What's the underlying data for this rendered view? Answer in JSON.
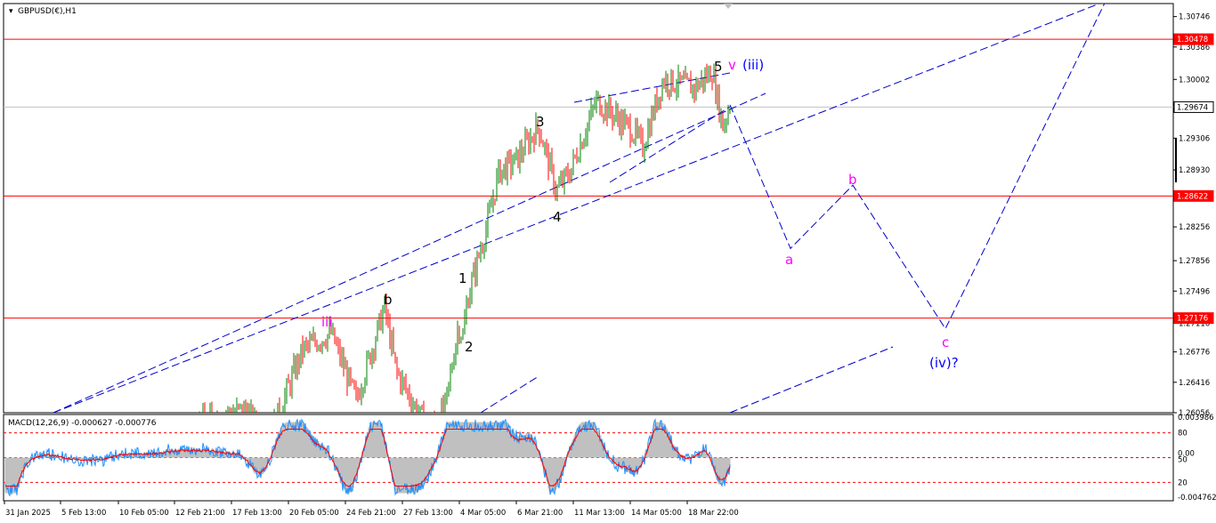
{
  "window": {
    "title": "GBPUSD(€),H1"
  },
  "main_axis": {
    "ticks": [
      "1.30746",
      "1.30386",
      "1.30002",
      "1.29306",
      "1.28930",
      "1.28256",
      "1.27856",
      "1.27496",
      "1.27116",
      "1.26776",
      "1.26416",
      "1.26056"
    ],
    "tick_values": [
      1.30746,
      1.30386,
      1.30002,
      1.29306,
      1.2893,
      1.28256,
      1.27856,
      1.27496,
      1.27116,
      1.26776,
      1.26416,
      1.26056
    ],
    "ylim": [
      1.26056,
      1.309
    ]
  },
  "horizontal_levels": [
    {
      "label": "1.30478",
      "value": 1.30478,
      "color": "#ff0000"
    },
    {
      "label": "1.29674",
      "value": 1.29674,
      "color": "#c0c0c0"
    },
    {
      "label": "1.28622",
      "value": 1.28622,
      "color": "#ff0000"
    },
    {
      "label": "1.27176",
      "value": 1.27176,
      "color": "#ff0000"
    }
  ],
  "time_axis": {
    "labels": [
      "31 Jan 2025",
      "5 Feb 13:00",
      "10 Feb 05:00",
      "12 Feb 21:00",
      "17 Feb 13:00",
      "20 Feb 05:00",
      "24 Feb 21:00",
      "27 Feb 13:00",
      "4 Mar 05:00",
      "6 Mar 21:00",
      "11 Mar 13:00",
      "14 Mar 05:00",
      "18 Mar 22:00"
    ]
  },
  "wave_labels": [
    {
      "text": "iii",
      "color": "#ff00ff"
    },
    {
      "text": "b",
      "color": "#000000"
    },
    {
      "text": "1",
      "color": "#000000"
    },
    {
      "text": "2",
      "color": "#000000"
    },
    {
      "text": "3",
      "color": "#000000"
    },
    {
      "text": "4",
      "color": "#000000"
    },
    {
      "text": "5",
      "color": "#000000"
    },
    {
      "text": "v",
      "color": "#ff00ff"
    },
    {
      "text": "(iii)",
      "color": "#0000ff"
    },
    {
      "text": "a",
      "color": "#ff00ff"
    },
    {
      "text": "b",
      "color": "#ff00ff"
    },
    {
      "text": "c",
      "color": "#ff00ff"
    },
    {
      "text": "(iv)?",
      "color": "#0000ff"
    }
  ],
  "macd": {
    "header": "MACD(12,26,9) -0.000627 -0.000776",
    "ticks": [
      "0.003986",
      "80",
      "0.00",
      "50",
      "20",
      "-0.004762"
    ]
  },
  "colors": {
    "bull": "#008000",
    "bear": "#ff0000",
    "projection": "#0000cd",
    "resistance": "#ff0000",
    "current": "#c0c0c0",
    "histogram": "#c0c0c0",
    "macd_main": "#1e90ff",
    "macd_signal": "#ff0000"
  },
  "chart_data": {
    "type": "candlestick",
    "symbol": "GBPUSD(€)",
    "timeframe": "H1",
    "path": [
      [
        0,
        1.254
      ],
      [
        60,
        1.2558
      ],
      [
        120,
        1.2548
      ],
      [
        180,
        1.2566
      ],
      [
        240,
        1.26
      ],
      [
        275,
        1.261
      ],
      [
        300,
        1.257
      ],
      [
        340,
        1.268
      ],
      [
        372,
        1.27
      ],
      [
        400,
        1.262
      ],
      [
        432,
        1.273
      ],
      [
        445,
        1.2655
      ],
      [
        480,
        1.2585
      ],
      [
        500,
        1.261
      ],
      [
        515,
        1.271
      ],
      [
        520,
        1.2695
      ],
      [
        525,
        1.274
      ],
      [
        550,
        1.284
      ],
      [
        560,
        1.289
      ],
      [
        580,
        1.2905
      ],
      [
        605,
        1.2945
      ],
      [
        625,
        1.2868
      ],
      [
        640,
        1.289
      ],
      [
        670,
        1.2975
      ],
      [
        710,
        1.294
      ],
      [
        722,
        1.292
      ],
      [
        745,
        1.3
      ],
      [
        780,
        1.299
      ],
      [
        800,
        1.301
      ],
      [
        812,
        1.2945
      ],
      [
        820,
        1.297
      ]
    ],
    "projection": [
      {
        "label": "start",
        "x": 820,
        "y": 1.297
      },
      {
        "label": "a",
        "x": 888,
        "y": 1.28
      },
      {
        "label": "b",
        "x": 958,
        "y": 1.2875
      },
      {
        "label": "c",
        "x": 1062,
        "y": 1.2705
      },
      {
        "label": "target",
        "x": 1250,
        "y": 1.311
      }
    ]
  }
}
